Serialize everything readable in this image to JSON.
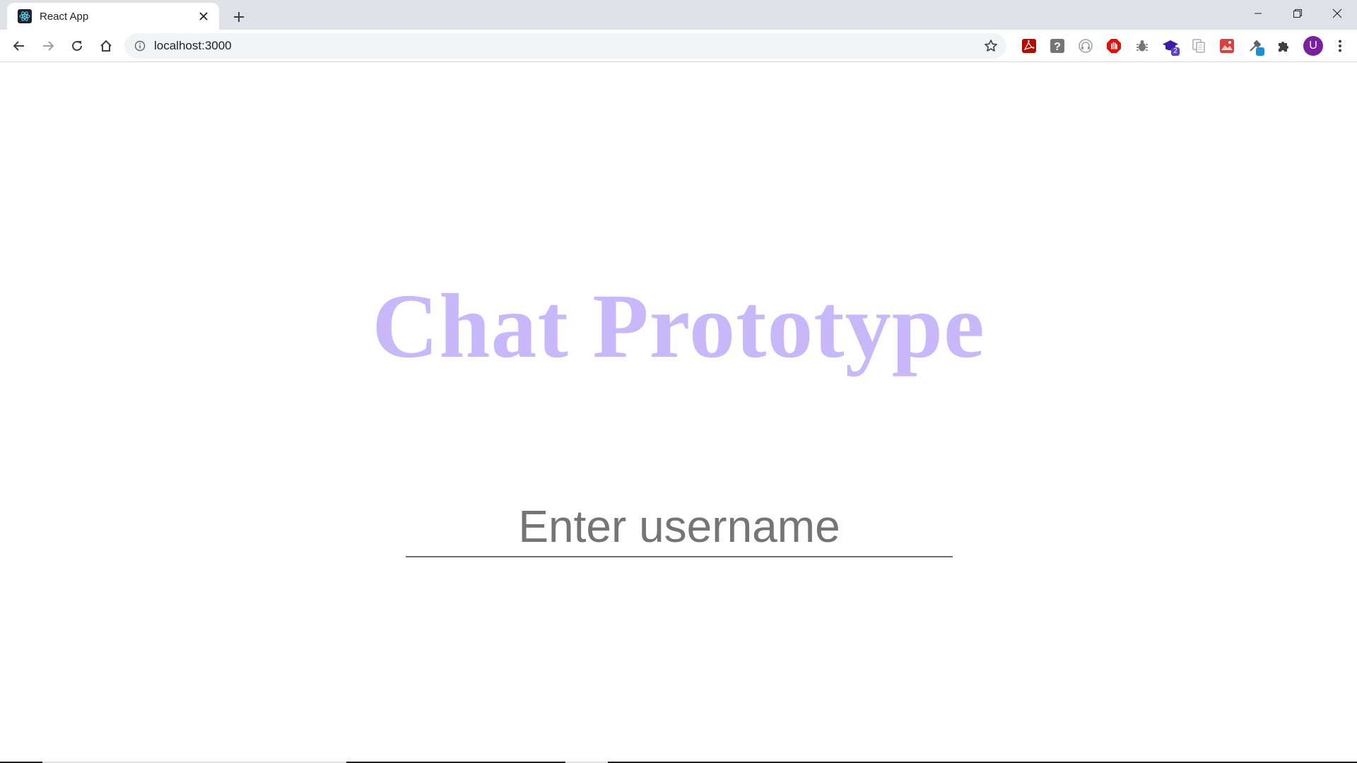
{
  "browser": {
    "tab": {
      "title": "React App",
      "favicon": "react-logo-icon"
    },
    "address": {
      "url": "localhost:3000"
    },
    "profile": {
      "initial": "U",
      "color": "#7b1fa2"
    },
    "extensions": [
      {
        "name": "acrobat-extension-icon",
        "badge": ""
      },
      {
        "name": "question-extension-icon",
        "badge": ""
      },
      {
        "name": "headphones-extension-icon",
        "badge": ""
      },
      {
        "name": "stop-hand-extension-icon",
        "badge": ""
      },
      {
        "name": "bug-extension-icon",
        "badge": ""
      },
      {
        "name": "graduation-cap-extension-icon",
        "badge": "2"
      },
      {
        "name": "copy-pages-extension-icon",
        "badge": ""
      },
      {
        "name": "picture-extension-icon",
        "badge": ""
      },
      {
        "name": "eyedropper-extension-icon",
        "badge": ""
      },
      {
        "name": "puzzle-extensions-icon",
        "badge": ""
      }
    ]
  },
  "app": {
    "title": "Chat Prototype",
    "title_color": "#c8b8fa",
    "username_input": {
      "placeholder": "Enter username",
      "value": ""
    }
  }
}
